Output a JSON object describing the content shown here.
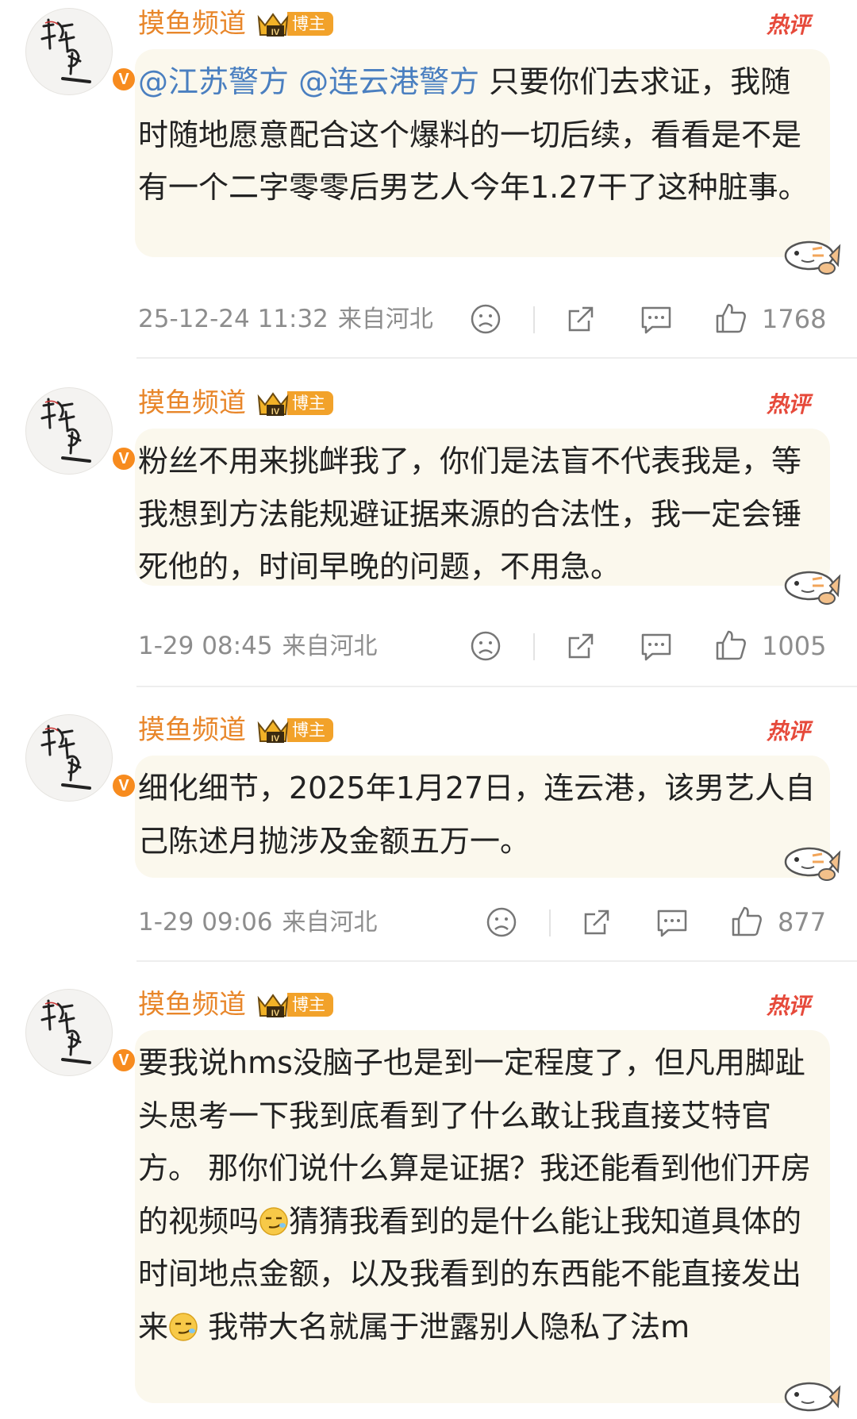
{
  "comments": [
    {
      "name": "摸鱼频道",
      "badge": "博主",
      "hot": "热评",
      "mentions": [
        "@江苏警方",
        "@连云港警方"
      ],
      "text": "只要你们去求证，我随时随地愿意配合这个爆料的一切后续，看看是不是有一个二字零零后男艺人今年1.27干了这种脏事。",
      "time": "25-12-24 11:32",
      "location": "来自河北",
      "likes": "1768"
    },
    {
      "name": "摸鱼频道",
      "badge": "博主",
      "hot": "热评",
      "text": "粉丝不用来挑衅我了，你们是法盲不代表我是，等我想到方法能规避证据来源的合法性，我一定会锤死他的，时间早晚的问题，不用急。",
      "time": "1-29 08:45",
      "location": "来自河北",
      "likes": "1005"
    },
    {
      "name": "摸鱼频道",
      "badge": "博主",
      "hot": "热评",
      "text": "细化细节，2025年1月27日，连云港，该男艺人自己陈述月抛涉及金额五万一。",
      "time": "1-29 09:06",
      "location": "来自河北",
      "likes": "877"
    },
    {
      "name": "摸鱼频道",
      "badge": "博主",
      "hot": "热评",
      "text_parts": [
        "要我说hms没脑子也是到一定程度了，但凡用脚趾头思考一下我到底看到了什么敢让我直接艾特官方。 那你们说什么算是证据？我还能看到他们开房的视频吗",
        "猜猜我看到的是什么能让我知道具体的时间地点金额，以及我看到的东西能不能直接发出来",
        " 我带大名就属于泄露别人隐私了法m"
      ]
    }
  ],
  "colors": {
    "name": "#e8862a",
    "mention": "#4a7fc0",
    "hot": "#e64a3b",
    "bubble": "#fbf8ed",
    "meta": "#8d8d8d"
  },
  "icons": [
    "avatar-calligraphy",
    "verified-v-icon",
    "crown-level-icon",
    "fish-sticker-icon",
    "sad-face-icon",
    "share-icon",
    "comment-icon",
    "like-thumb-icon",
    "smirk-emoji-icon"
  ]
}
